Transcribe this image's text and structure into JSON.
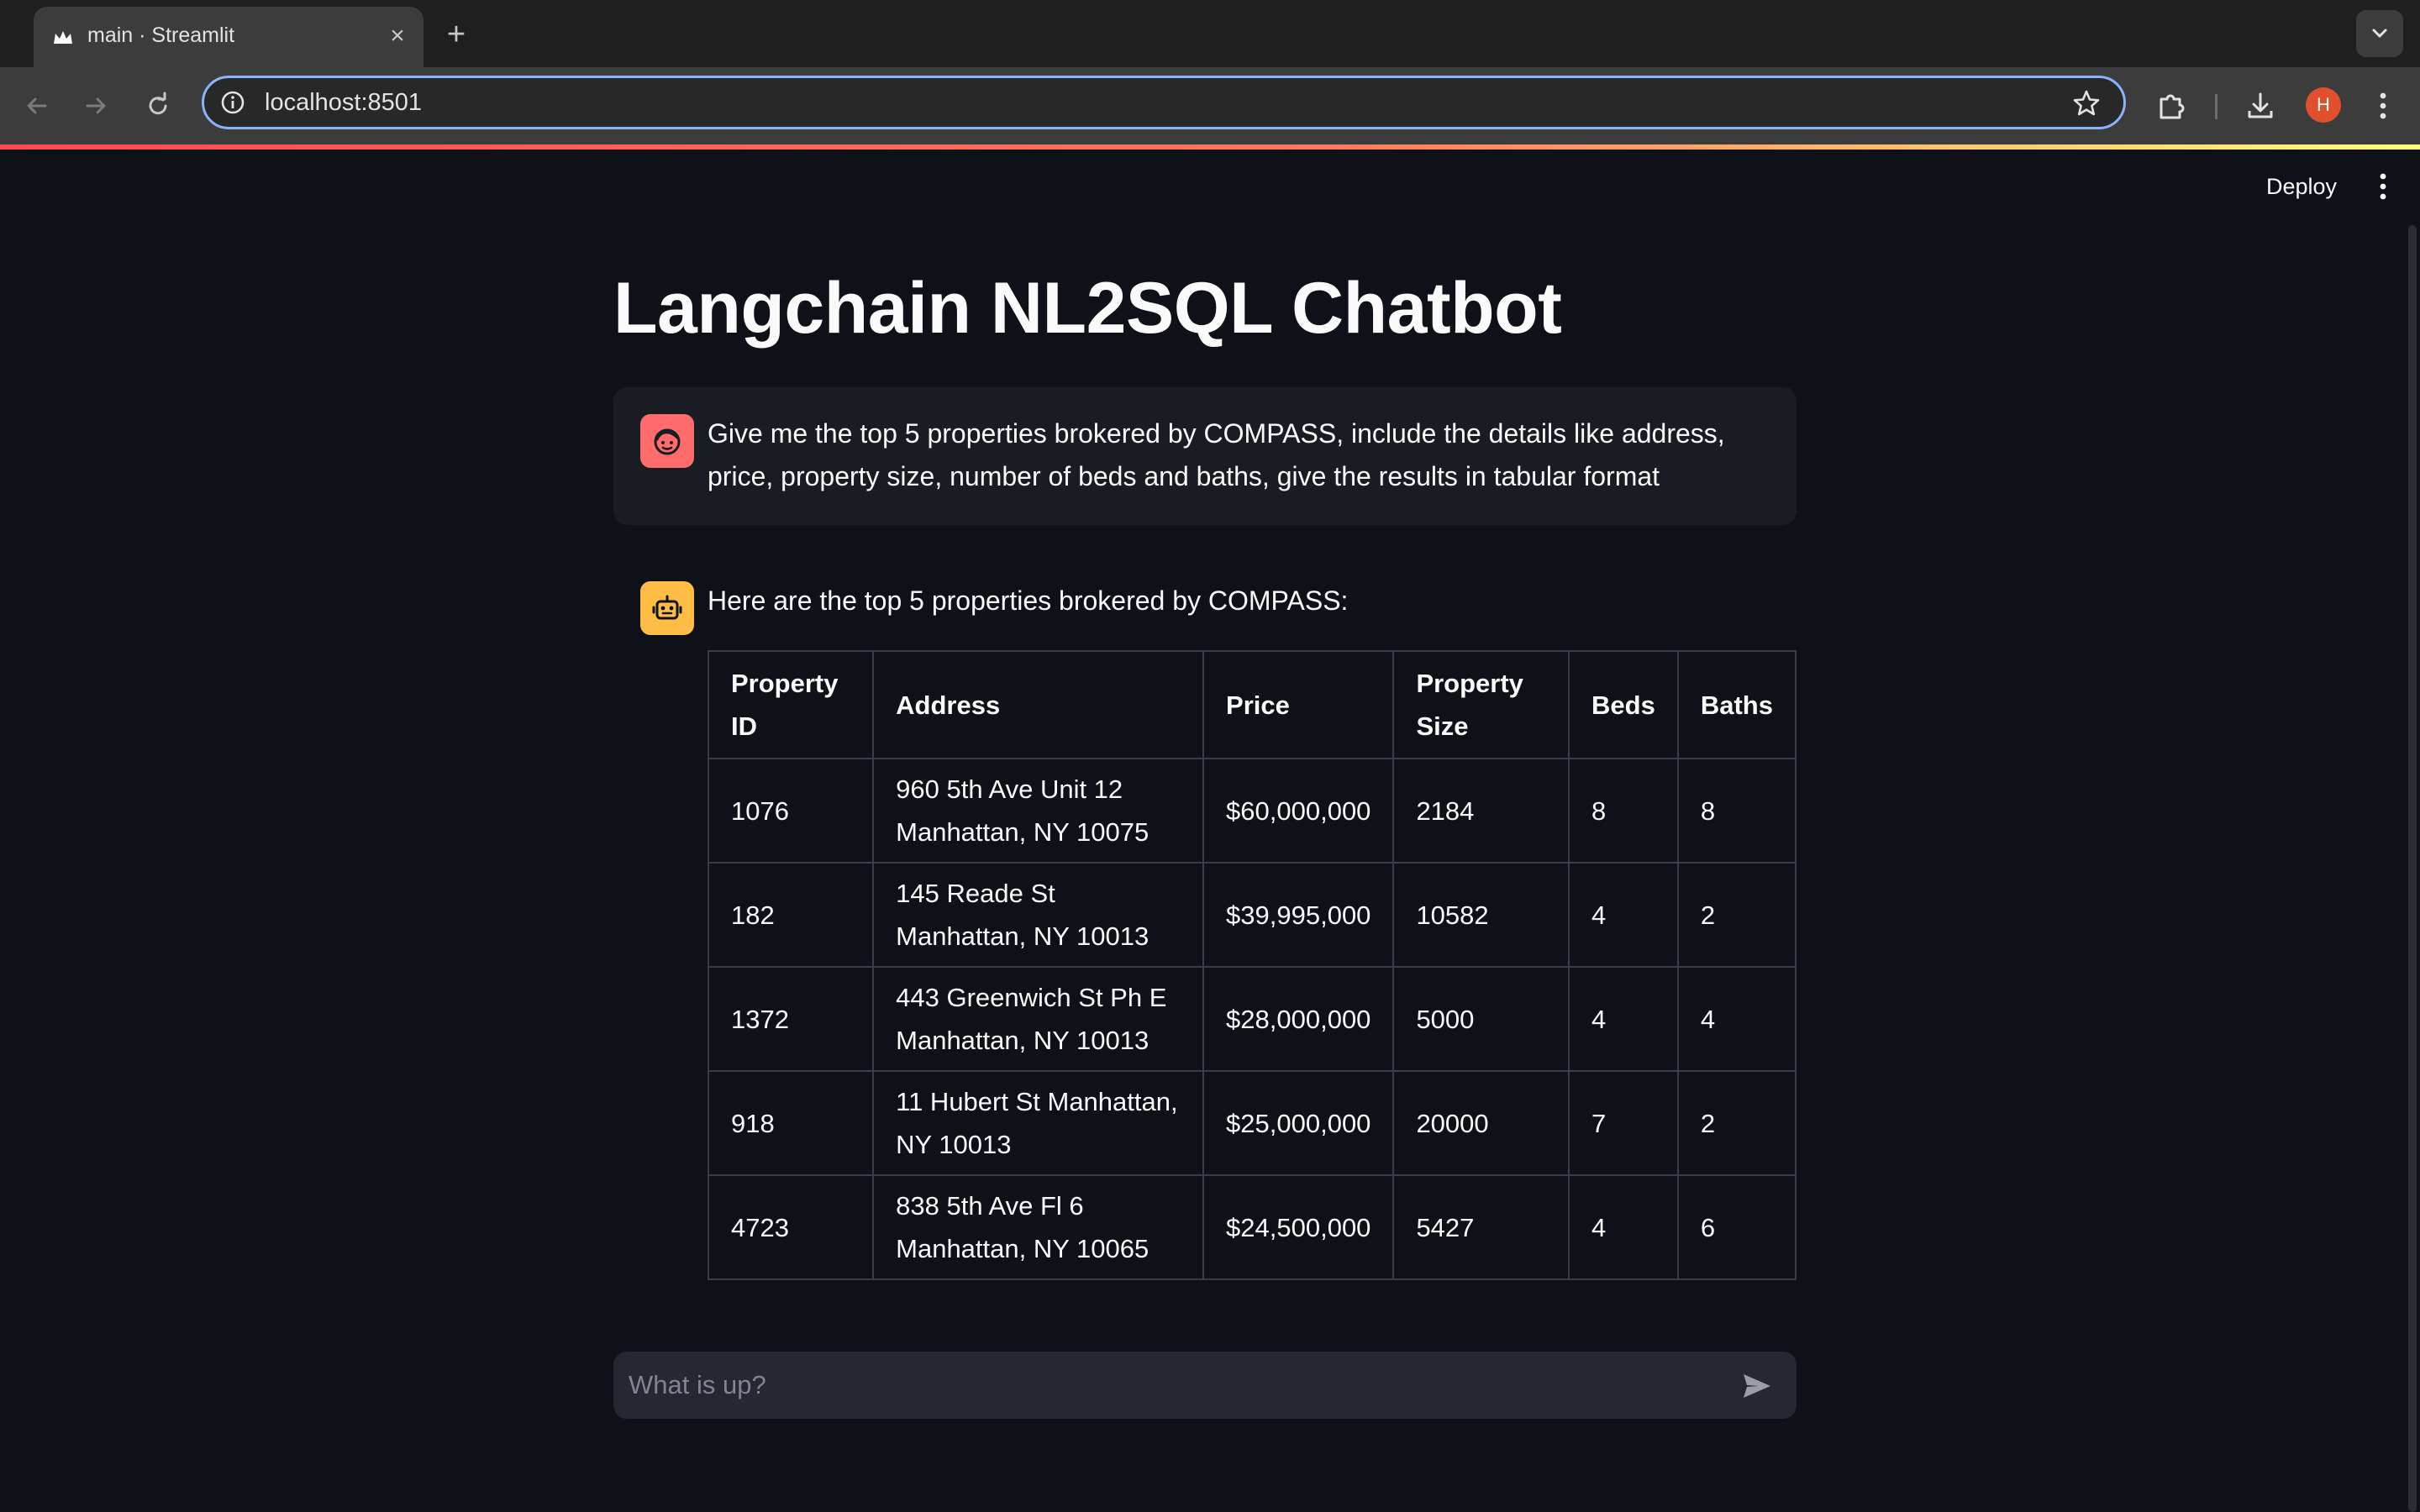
{
  "browser": {
    "tab_title": "main · Streamlit",
    "tab_close": "×",
    "new_tab": "+",
    "url": "localhost:8501",
    "profile_initial": "H"
  },
  "app": {
    "deploy_label": "Deploy",
    "title": "Langchain NL2SQL Chatbot"
  },
  "chat": {
    "user_message": "Give me the top 5 properties brokered by COMPASS, include the details like address, price, property size, number of beds and baths, give the results in tabular format",
    "assistant_intro": "Here are the top 5 properties brokered by COMPASS:",
    "table": {
      "headers": [
        "Property ID",
        "Address",
        "Price",
        "Property Size",
        "Beds",
        "Baths"
      ],
      "rows": [
        [
          "1076",
          "960 5th Ave Unit 12 Manhattan, NY 10075",
          "$60,000,000",
          "2184",
          "8",
          "8"
        ],
        [
          "182",
          "145 Reade St Manhattan, NY 10013",
          "$39,995,000",
          "10582",
          "4",
          "2"
        ],
        [
          "1372",
          "443 Greenwich St Ph E Manhattan, NY 10013",
          "$28,000,000",
          "5000",
          "4",
          "4"
        ],
        [
          "918",
          "11 Hubert St Manhattan, NY 10013",
          "$25,000,000",
          "20000",
          "7",
          "2"
        ],
        [
          "4723",
          "838 5th Ave Fl 6 Manhattan, NY 10065",
          "$24,500,000",
          "5427",
          "4",
          "6"
        ]
      ]
    },
    "input_placeholder": "What is up?"
  },
  "colors": {
    "background": "#0e1117",
    "user_avatar": "#ff6c6c",
    "bot_avatar": "#ffbd45",
    "url_focus": "#8ab4f8"
  },
  "icons": {
    "tab_favicon": "streamlit-crown-icon",
    "back": "arrow-left-icon",
    "forward": "arrow-right-icon",
    "reload": "reload-icon",
    "site_info": "info-icon",
    "bookmark": "star-icon",
    "extensions": "puzzle-icon",
    "downloads": "download-icon",
    "browser_menu": "kebab-icon",
    "user_avatar": "face-icon",
    "bot_avatar": "robot-icon",
    "send": "send-icon"
  }
}
